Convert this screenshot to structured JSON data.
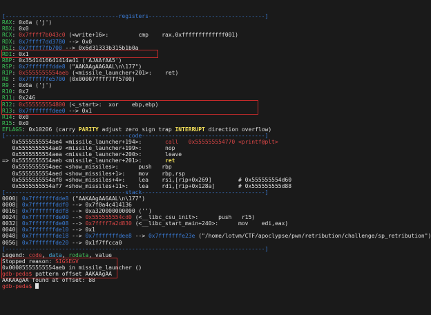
{
  "terminal": {
    "lines": [
      [
        [
          "sep",
          "[----------------------------------registers-----------------------------------]"
        ]
      ],
      [
        [
          "reg",
          "RAX"
        ],
        [
          "white",
          ": 0x6a ('j')"
        ]
      ],
      [
        [
          "reg",
          "RBX"
        ],
        [
          "white",
          ": 0x0"
        ]
      ],
      [
        [
          "reg",
          "RCX"
        ],
        [
          "white",
          ": "
        ],
        [
          "code",
          "0x7ffff7b043c0"
        ],
        [
          "white",
          " (<write+16>:         cmp    rax,0xfffffffffffff001)"
        ]
      ],
      [
        [
          "reg",
          "RDX"
        ],
        [
          "white",
          ": "
        ],
        [
          "ptr",
          "0x7ffff7dd3780"
        ],
        [
          "white",
          " --> 0x0"
        ]
      ],
      [
        [
          "reg",
          "RSI"
        ],
        [
          "white",
          ": "
        ],
        [
          "ptr",
          "0x7ffff7fb700"
        ],
        [
          "white",
          " --> 0x6d31333b315b1b0a"
        ]
      ],
      [
        [
          "reg",
          "RDI"
        ],
        [
          "white",
          ": 0x1"
        ]
      ],
      [
        [
          "reg",
          "RBP"
        ],
        [
          "white",
          ": 0x3541416641414a41 ('AJAAfAA5')"
        ]
      ],
      [
        [
          "reg",
          "RSP"
        ],
        [
          "white",
          ": "
        ],
        [
          "ptr",
          "0x7fffffffdde8"
        ],
        [
          "white",
          " (\"AAKAAgAA6AAL\\n\\177\")"
        ]
      ],
      [
        [
          "reg",
          "RIP"
        ],
        [
          "white",
          ": "
        ],
        [
          "code",
          "0x5555555554aeb"
        ],
        [
          "white",
          " (<missile_launcher+201>:    ret)"
        ]
      ],
      [
        [
          "reg",
          "R8 "
        ],
        [
          "white",
          ": "
        ],
        [
          "ptr",
          "0x7ffff7fe5700"
        ],
        [
          "white",
          " (0x00007ffff7ff5700)"
        ]
      ],
      [
        [
          "reg",
          "R9 "
        ],
        [
          "white",
          ": 0x6a ('j')"
        ]
      ],
      [
        [
          "reg",
          "R10"
        ],
        [
          "white",
          ": 0x7"
        ]
      ],
      [
        [
          "reg",
          "R11"
        ],
        [
          "white",
          ": 0x246"
        ]
      ],
      [
        [
          "reg",
          "R12"
        ],
        [
          "white",
          ": "
        ],
        [
          "code",
          "0x555555554800"
        ],
        [
          "white",
          " (<_start>:  xor    ebp,ebp)"
        ]
      ],
      [
        [
          "reg",
          "R13"
        ],
        [
          "white",
          ": "
        ],
        [
          "ptr",
          "0x7fffffffdee0"
        ],
        [
          "white",
          " --> 0x1"
        ]
      ],
      [
        [
          "reg",
          "R14"
        ],
        [
          "white",
          ": 0x0"
        ]
      ],
      [
        [
          "reg",
          "R15"
        ],
        [
          "white",
          ": 0x0"
        ]
      ],
      [
        [
          "reg",
          "EFLAGS"
        ],
        [
          "white",
          ": 0x10206 (carry "
        ],
        [
          "bold-yellow",
          "PARITY"
        ],
        [
          "white",
          " adjust zero sign trap "
        ],
        [
          "bold-yellow",
          "INTERRUPT"
        ],
        [
          "white",
          " direction overflow)"
        ]
      ],
      [
        [
          "sep",
          "[-------------------------------------code-------------------------------------]"
        ]
      ],
      [
        [
          "white",
          "   0x5555555554ae4 <missile_launcher+194>:       "
        ],
        [
          "code",
          "call   0x555555554770 <printf@plt>"
        ]
      ],
      [
        [
          "white",
          "   0x5555555554ae9 <missile_launcher+199>:       "
        ],
        [
          "white",
          "nop"
        ]
      ],
      [
        [
          "white",
          "   0x5555555554aea <missile_launcher+200>:       "
        ],
        [
          "white",
          "leave"
        ]
      ],
      [
        [
          "white",
          "=> 0x5555555554aeb <missile_launcher+201>:       "
        ],
        [
          "bold-yellow",
          "ret"
        ]
      ],
      [
        [
          "white",
          "   0x5555555554aec <show_missiles>:      push   rbp"
        ]
      ],
      [
        [
          "white",
          "   0x5555555554aed <show_missiles+1>:    mov    rbp,rsp"
        ]
      ],
      [
        [
          "white",
          "   0x5555555554af0 <show_missiles+4>:    lea    rsi,[rip+0x269]        # 0x555555554d60"
        ]
      ],
      [
        [
          "white",
          "   0x5555555554af7 <show_missiles+11>:   lea    rdi,[rip+0x128a]       # 0x555555555d88"
        ]
      ],
      [
        [
          "sep",
          "[------------------------------------stack-------------------------------------]"
        ]
      ],
      [
        [
          "white",
          "0000| "
        ],
        [
          "ptr",
          "0x7fffffffdde8"
        ],
        [
          "white",
          " (\"AAKAAgAA6AAL\\n\\177\")"
        ]
      ],
      [
        [
          "white",
          "0008| "
        ],
        [
          "ptr",
          "0x7fffffffddf0"
        ],
        [
          "white",
          " --> 0x7f0a4c414136"
        ]
      ],
      [
        [
          "white",
          "0016| "
        ],
        [
          "ptr",
          "0x7fffffffddf8"
        ],
        [
          "white",
          " --> 0xa320000000000 ('')"
        ]
      ],
      [
        [
          "white",
          "0024| "
        ],
        [
          "ptr",
          "0x7fffffffde00"
        ],
        [
          "white",
          " --> "
        ],
        [
          "code",
          "0x555555554cd0"
        ],
        [
          "white",
          " (<__libc_csu_init>:      push   r15)"
        ]
      ],
      [
        [
          "white",
          "0032| "
        ],
        [
          "ptr",
          "0x7fffffffde08"
        ],
        [
          "white",
          " --> "
        ],
        [
          "code",
          "0x7ffff7a2d830"
        ],
        [
          "white",
          " (<__libc_start_main+240>:      mov    edi,eax)"
        ]
      ],
      [
        [
          "white",
          "0040| "
        ],
        [
          "ptr",
          "0x7fffffffde10"
        ],
        [
          "white",
          " --> 0x1"
        ]
      ],
      [
        [
          "white",
          "0048| "
        ],
        [
          "ptr",
          "0x7fffffffde18"
        ],
        [
          "white",
          " --> "
        ],
        [
          "ptr",
          "0x7fffffffdee8"
        ],
        [
          "white",
          " --> "
        ],
        [
          "ptr",
          "0x7fffffffe23e"
        ],
        [
          "white",
          " (\"/home/lotvm/CTF/apoclypse/pwn/retribution/challenge/sp_retribution\")"
        ]
      ],
      [
        [
          "white",
          "0056| "
        ],
        [
          "ptr",
          "0x7fffffffde20"
        ],
        [
          "white",
          " --> 0x1f7ffcca0"
        ]
      ],
      [
        [
          "sep",
          "[------------------------------------------------------------------------------]"
        ]
      ],
      [
        [
          "white",
          "Legend: "
        ],
        [
          "code",
          "code"
        ],
        [
          "white",
          ", "
        ],
        [
          "data",
          "data"
        ],
        [
          "white",
          ", "
        ],
        [
          "rodata",
          "rodata"
        ],
        [
          "white",
          ", value"
        ]
      ],
      [
        [
          "white",
          "Stopped reason: "
        ],
        [
          "red",
          "SIGSEGV"
        ]
      ],
      [
        [
          "white",
          "0x00005555555554aeb in missile_launcher ()"
        ]
      ],
      [
        [
          "red",
          "gdb-peda$ "
        ],
        [
          "white",
          "pattern offset AAKAAgAA"
        ]
      ],
      [
        [
          "white",
          "AAKAAgAA found at offset: 88"
        ]
      ],
      [
        [
          "red",
          "gdb-peda$ "
        ],
        [
          "cursor",
          ""
        ]
      ]
    ]
  },
  "colors": {
    "background": "#1a1a1a",
    "separator": "#3a7bd5",
    "register": "#3cc85a",
    "code": "#d64545",
    "highlight_box": "#c42a2a"
  }
}
